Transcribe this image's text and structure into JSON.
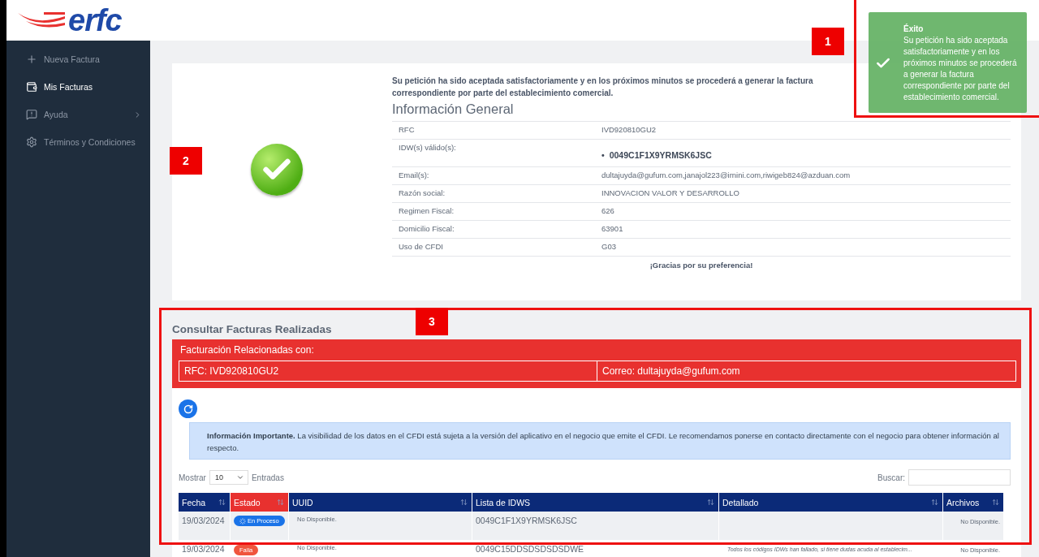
{
  "header": {
    "logo": "erfc"
  },
  "sidebar": {
    "items": [
      {
        "label": "Nueva Factura",
        "selected": false,
        "expandable": false
      },
      {
        "label": "Mis Facturas",
        "selected": true,
        "expandable": false
      },
      {
        "label": "Ayuda",
        "selected": false,
        "expandable": true
      },
      {
        "label": "Términos y Condiciones",
        "selected": false,
        "expandable": false
      }
    ]
  },
  "toast": {
    "title": "Éxito",
    "message": "Su petición ha sido aceptada satisfactoriamente y en los próximos minutos se procederá a generar la factura correspondiente por parte del establecimiento comercial."
  },
  "result": {
    "message": "Su petición ha sido aceptada satisfactoriamente y en los próximos minutos se procederá a generar la factura correspondiente por parte del establecimiento comercial.",
    "heading": "Información General",
    "fields": [
      {
        "label": "RFC",
        "value": "IVD920810GU2",
        "kind": "text"
      },
      {
        "label": "IDW(s) válido(s):",
        "marker": "•",
        "value": "0049C1F1X9YRMSK6JSC",
        "kind": "bullet"
      },
      {
        "label": "Email(s):",
        "value": "dultajuyda@gufum.com,janajol223@irnini.com,riwigeb824@azduan.com",
        "kind": "text"
      },
      {
        "label": "Razón social:",
        "value": "INNOVACION VALOR Y DESARROLLO",
        "kind": "text"
      },
      {
        "label": "Regimen Fiscal:",
        "value": "626",
        "kind": "text"
      },
      {
        "label": "Domicilio Fiscal:",
        "value": "63901",
        "kind": "text"
      },
      {
        "label": "Uso de CFDI",
        "value": "G03",
        "kind": "text"
      }
    ],
    "thanks": "¡Gracias por su preferencia!"
  },
  "invoices": {
    "title": "Consultar Facturas Realizadas",
    "related_title": "Facturación Relacionadas con:",
    "rfc": "RFC: IVD920810GU2",
    "email": "Correo: dultajuyda@gufum.com",
    "notice": "**Información Importante.** La visibilidad de los datos en el CFDI está sujeta a la versión del aplicativo en el negocio que emite el CFDI. Le recomendamos ponerse en contacto directamente con el negocio para obtener información al respecto.",
    "show_label": "Mostrar",
    "page_size": "10",
    "entries_label": "Entradas",
    "search_label": "Buscar:",
    "columns": [
      {
        "label": "Fecha",
        "selected": false
      },
      {
        "label": "Estado",
        "selected": true
      },
      {
        "label": "UUID",
        "selected": false
      },
      {
        "label": "Lista de IDWS",
        "selected": false
      },
      {
        "label": "Detallado",
        "selected": false
      },
      {
        "label": "Archivos",
        "selected": false
      }
    ],
    "rows": [
      {
        "fecha": "19/03/2024",
        "estado": "En Proceso",
        "kind": "processing",
        "uuid": "No Disponible.",
        "idws": "0049C1F1X9YRMSK6JSC",
        "detalle": "",
        "archivos": "No Disponible."
      },
      {
        "fecha": "19/03/2024",
        "estado": "Falla",
        "kind": "failed",
        "uuid": "No Disponible.",
        "idws": "0049C15DDSDSDSDSDWE",
        "detalle": "Todos los códigos IDWs han fallado, si tiene dudas acuda al establecim...",
        "archivos": "No Disponible."
      }
    ]
  },
  "annotations": [
    {
      "label": "1",
      "kind": "boxed"
    },
    {
      "label": "2",
      "kind": "plain"
    },
    {
      "label": "3",
      "kind": "boxed"
    }
  ]
}
